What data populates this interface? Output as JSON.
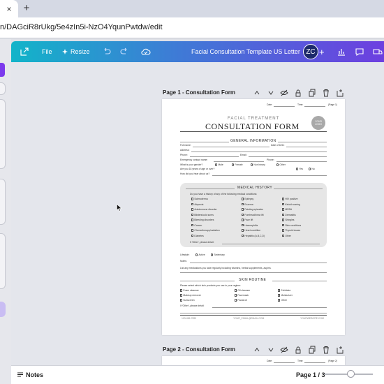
{
  "browser": {
    "tab_close": "×",
    "new_tab": "+",
    "url": "n/DAGciR8rUkg/5e4zIn5i-NzO4YqunPwtdw/edit"
  },
  "header": {
    "file_label": "File",
    "resize_label": "Resize",
    "doc_title": "Facial Consultation Template US Letter",
    "avatar_initials": "ZC",
    "add_label": "+"
  },
  "pages": [
    {
      "label": "Page 1 - Consultation Form"
    },
    {
      "label": "Page 2 - Consultation Form"
    }
  ],
  "form": {
    "date_label": "Date:",
    "time_label": "Time:",
    "page_tag": "(Page 1)",
    "page2_tag": "(Page 2)",
    "subtitle": "FACIAL TREATMENT",
    "title": "CONSULTATION FORM",
    "logo_text": "YOUR LOGO",
    "general_heading": "GENERAL INFORMATION",
    "full_name": "Full name:",
    "dob": "Date of birth:",
    "address": "Address:",
    "phone": "Phone:",
    "email": "Email:",
    "emergency": "Emergency contact name:",
    "phone2": "Phone:",
    "gender_q": "What is your gender?",
    "gender_opts": [
      "Male",
      "Female",
      "Non binary",
      "Other"
    ],
    "age_q": "Are you 18 years of age or over?",
    "yes": "Yes",
    "no": "No",
    "heard": "How did you hear about us?",
    "medical_heading": "MEDICAL HISTORY",
    "medical_q": "Do you have a history of any of the following medical conditions:",
    "conditions_col1": [
      "Scleroderma",
      "Alopecia",
      "Autoimmune disorder",
      "Blisters/cold sores",
      "Bleeding disorders",
      "Cancer",
      "Chemotherapy/radiation",
      "Diabetes"
    ],
    "conditions_col2": [
      "Epilepsy",
      "Eczema",
      "Fainting episodes",
      "Forehead/brow lift",
      "Face lift",
      "Haemophilia",
      "Heart condition",
      "Hepatitis (A,B,C,D)"
    ],
    "conditions_col3": [
      "HIV positive",
      "Keloid scaring",
      "MRSA",
      "Dermatitis",
      "Shingles",
      "Skin conditions",
      "Thyroid issues",
      "Other"
    ],
    "other_detail": "If 'Other', please detail:",
    "lifestyle": "Lifestyle:",
    "active": "Active",
    "sedentary": "Sedentary",
    "notes": "Notes:",
    "medications": "List any medications you take regularly including vitamins, herbal supplements, aspirin.",
    "skin_heading": "SKIN ROUTINE",
    "skin_q": "Please select which skin products you use in your regime:",
    "skin_col1": [
      "Foam cleanser",
      "Makeup remover",
      "Sunscreen"
    ],
    "skin_col2": [
      "Oil cleanser",
      "Facemask",
      "Facial oil"
    ],
    "skin_col3": [
      "Exfoliator",
      "Moisturizer",
      "Other"
    ],
    "skin_other": "If 'Other', please detail:",
    "footer_phone": "123-456-7890",
    "footer_email": "YOUR_EMAIL@EMAIL.COM",
    "footer_web": "YOURWEBSITE.COM"
  },
  "bottom": {
    "notes_label": "Notes",
    "page_indicator": "Page 1 / 3"
  },
  "colors": {
    "header_gradient_start": "#12b4c9",
    "header_gradient_end": "#6d3fe0",
    "accent_purple": "#7c3aed",
    "avatar_bg": "#1d2a6b",
    "medical_panel": "#e6e6e6"
  }
}
